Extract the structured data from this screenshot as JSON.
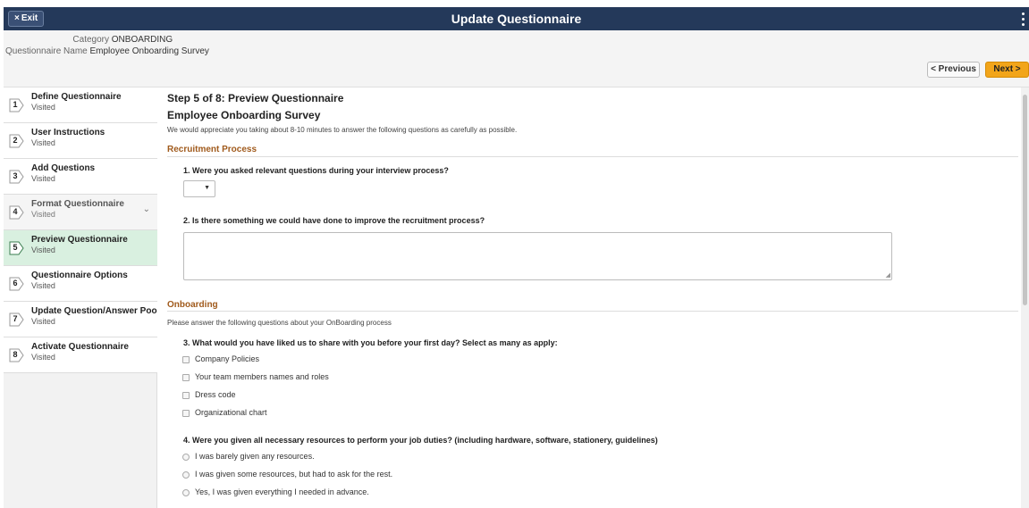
{
  "window": {
    "title": "Update Questionnaire",
    "exit_label": "Exit",
    "exit_icon": "×",
    "accent": "#24395a"
  },
  "header": {
    "category_label": "Category",
    "category_value": "ONBOARDING",
    "name_label": "Questionnaire Name",
    "name_value": "Employee Onboarding Survey",
    "prev_label": "< Previous",
    "next_label": "Next >",
    "next_color": "#f2a51a"
  },
  "sidebar": {
    "steps": [
      {
        "num": "1",
        "title": "Define Questionnaire",
        "status": "Visited"
      },
      {
        "num": "2",
        "title": "User Instructions",
        "status": "Visited"
      },
      {
        "num": "3",
        "title": "Add Questions",
        "status": "Visited"
      },
      {
        "num": "4",
        "title": "Format Questionnaire",
        "status": "Visited"
      },
      {
        "num": "5",
        "title": "Preview Questionnaire",
        "status": "Visited"
      },
      {
        "num": "6",
        "title": "Questionnaire Options",
        "status": "Visited"
      },
      {
        "num": "7",
        "title": "Update Question/Answer Pool",
        "status": "Visited"
      },
      {
        "num": "8",
        "title": "Activate Questionnaire",
        "status": "Visited"
      }
    ],
    "active_color": "#d9f0e0"
  },
  "main": {
    "step_heading": "Step 5 of 8: Preview Questionnaire",
    "survey_title": "Employee Onboarding Survey",
    "intro": "We would appreciate you taking about 8-10 minutes to answer the following questions as carefully as possible.",
    "sections": [
      {
        "title": "Recruitment Process",
        "description": ""
      },
      {
        "title": "Onboarding",
        "description": "Please answer the following questions about your OnBoarding process"
      }
    ],
    "section_color": "#a05a1c",
    "questions": [
      {
        "label": "1. Were you asked relevant questions during your interview process?",
        "dropdown_value": ""
      },
      {
        "label": "2. Is there something we could have done to improve the recruitment process?",
        "answer": ""
      },
      {
        "label": "3. What would you have liked us to share with you before your first day? Select as many as apply:",
        "options": [
          "Company Policies",
          "Your team members names and roles",
          "Dress code",
          "Organizational chart"
        ]
      },
      {
        "label": "4. Were you given all necessary resources to perform your job duties? (including hardware, software, stationery, guidelines)",
        "options": [
          "I was barely given any resources.",
          "I was given some resources, but had to ask for the rest.",
          "Yes, I was given everything I needed in advance."
        ]
      }
    ]
  }
}
